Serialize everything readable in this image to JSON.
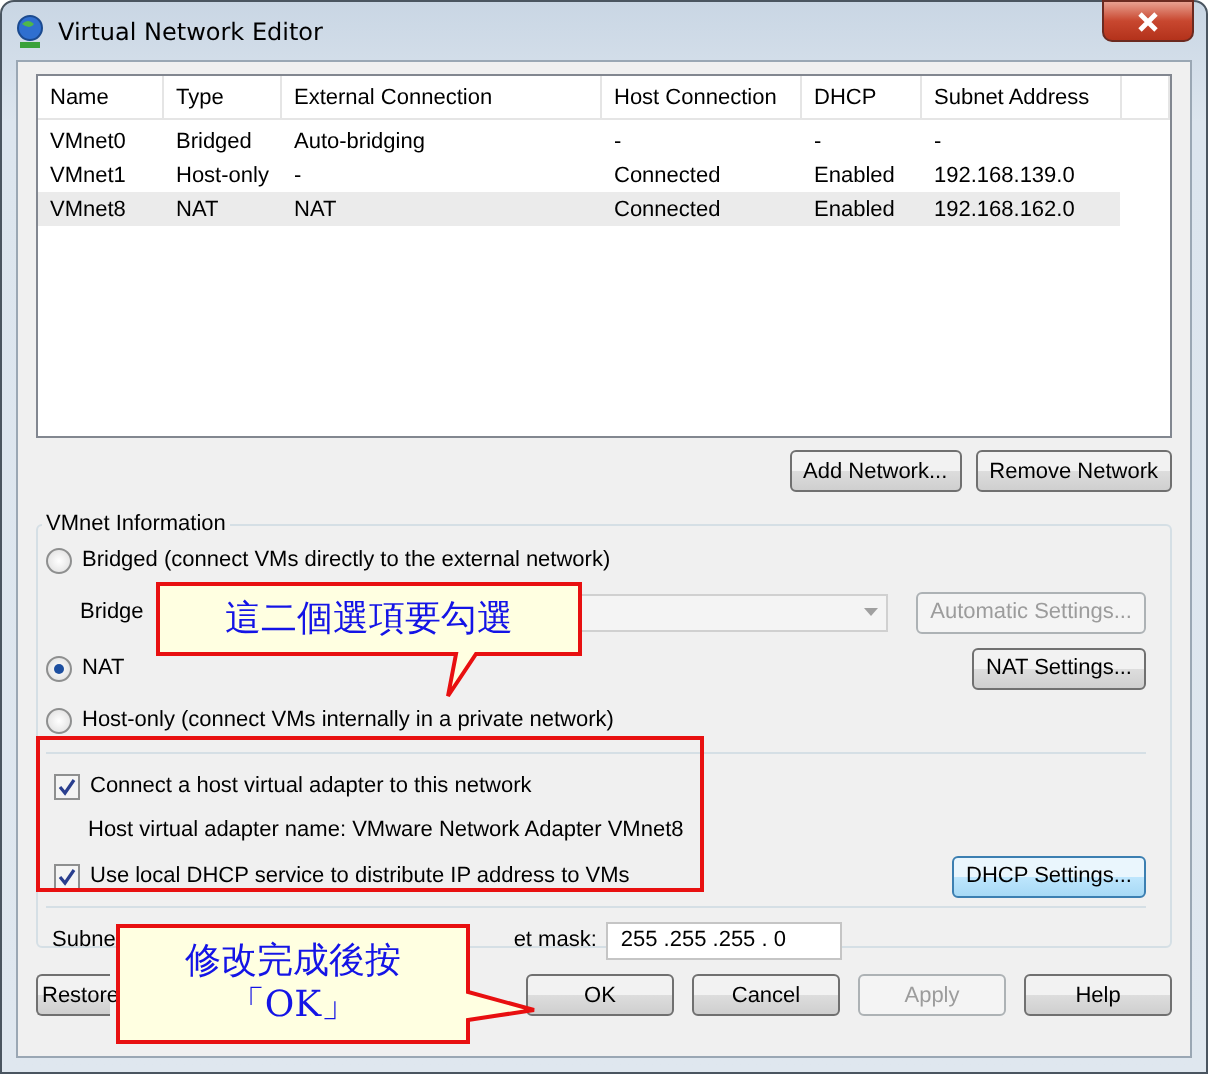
{
  "window": {
    "title": "Virtual Network Editor"
  },
  "table": {
    "columns": [
      "Name",
      "Type",
      "External Connection",
      "Host Connection",
      "DHCP",
      "Subnet Address"
    ],
    "rows": [
      {
        "cells": [
          "VMnet0",
          "Bridged",
          "Auto-bridging",
          "-",
          "-",
          "-"
        ],
        "selected": false
      },
      {
        "cells": [
          "VMnet1",
          "Host-only",
          "-",
          "Connected",
          "Enabled",
          "192.168.139.0"
        ],
        "selected": false
      },
      {
        "cells": [
          "VMnet8",
          "NAT",
          "NAT",
          "Connected",
          "Enabled",
          "192.168.162.0"
        ],
        "selected": true
      }
    ]
  },
  "table_buttons": [
    "Add Network...",
    "Remove Network"
  ],
  "vmnet_information": {
    "title": "VMnet Information",
    "bridged_option": {
      "label": "Bridged (connect VMs directly to the external network)",
      "selected": false
    },
    "bridged_to_label": "Bridge",
    "automatic_settings": {
      "label": "Automatic Settings...",
      "disabled": true
    },
    "nat_option": {
      "label": "NAT",
      "selected": true
    },
    "nat_settings": {
      "label": "NAT Settings...",
      "disabled": false
    },
    "host_only_option": {
      "label": "Host-only (connect VMs internally in a private network)",
      "selected": false
    },
    "connect_adapter": {
      "label": "Connect a host virtual adapter to this network",
      "checked": true
    },
    "adapter_name": "Host virtual adapter name: VMware Network Adapter VMnet8",
    "use_dhcp": {
      "label": "Use local DHCP service to distribute IP address to VMs",
      "checked": true
    },
    "dhcp_settings": {
      "label": "DHCP Settings...",
      "disabled": false
    },
    "subnet_ip_label": "Subne",
    "subnet_mask_label": "et mask:",
    "subnet_mask": "255 .255 .255 . 0"
  },
  "bottom_buttons": [
    {
      "label": "Restore",
      "disabled": false
    },
    {
      "label": "OK",
      "disabled": false
    },
    {
      "label": "Cancel",
      "disabled": false
    },
    {
      "label": "Apply",
      "disabled": true
    },
    {
      "label": "Help",
      "disabled": false
    }
  ],
  "annotations": [
    {
      "lines": [
        "這二個選項要勾選"
      ]
    },
    {
      "lines": [
        "修改完成後按",
        "「OK」"
      ]
    }
  ]
}
